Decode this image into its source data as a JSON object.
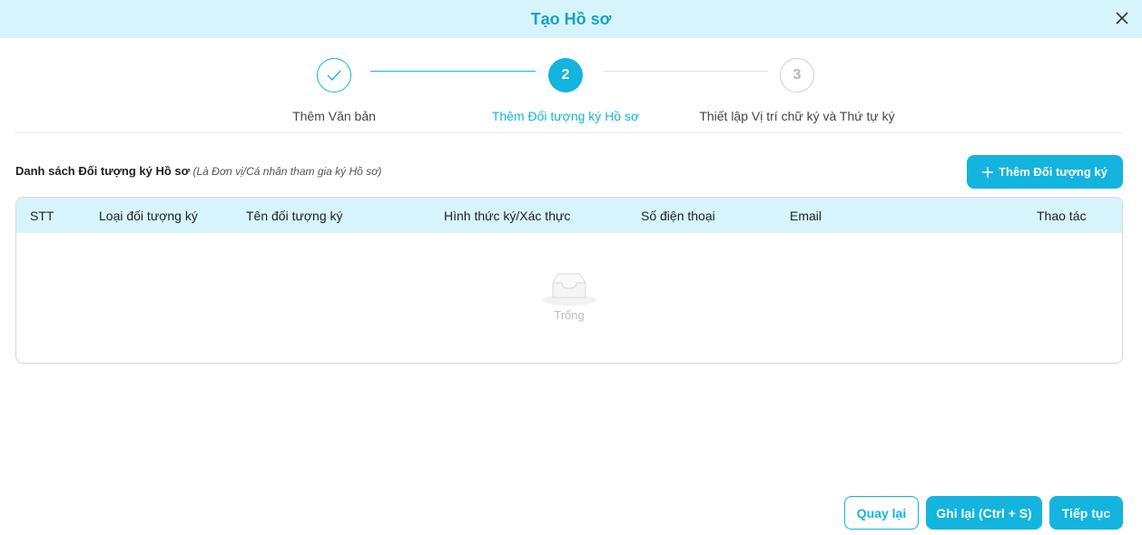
{
  "header": {
    "title": "Tạo Hồ sơ"
  },
  "colors": {
    "accent": "#13b4de",
    "header_bg": "#d6f4fb"
  },
  "stepper": {
    "steps": [
      {
        "number": "",
        "label": "Thêm Văn bản",
        "status": "done"
      },
      {
        "number": "2",
        "label": "Thêm Đối tượng ký Hồ sơ",
        "status": "active"
      },
      {
        "number": "3",
        "label": "Thiết lập Vị trí chữ ký và Thứ tự ký",
        "status": "pending"
      }
    ]
  },
  "section": {
    "title": "Danh sách Đối tượng ký Hồ sơ",
    "subtitle": "(Là Đơn vị/Cá nhân tham gia ký Hồ sơ)",
    "add_button_label": "Thêm Đối tượng ký"
  },
  "table": {
    "columns": [
      "STT",
      "Loại đối tượng ký",
      "Tên đối tượng ký",
      "Hình thức ký/Xác thực",
      "Số điện thoại",
      "Email",
      "Thao tác"
    ],
    "rows": [],
    "empty_label": "Trống"
  },
  "footer": {
    "back_label": "Quay lại",
    "save_label": "Ghi lại (Ctrl + S)",
    "next_label": "Tiếp tục"
  }
}
